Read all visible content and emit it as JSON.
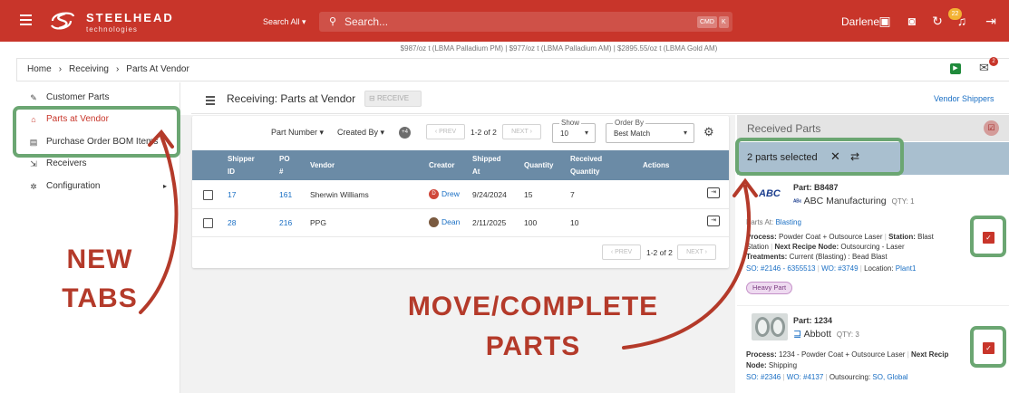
{
  "topbar": {
    "brand_name": "STEELHEAD",
    "brand_sub": "technologies",
    "search_scope": "Search All",
    "search_placeholder": "Search...",
    "kbd_1": "CMD",
    "kbd_2": "K",
    "user_name": "Darlene",
    "notification_count": "22",
    "brand_color": "#c8352a"
  },
  "metal_prices": "$987/oz t (LBMA Palladium PM)   |   $977/oz t (LBMA Palladium AM)   |   $2895.55/oz t (LBMA Gold AM)",
  "breadcrumb": {
    "items": [
      "Home",
      "Receiving",
      "Parts At Vendor"
    ],
    "mail_badge": "2"
  },
  "sidebar": {
    "items": [
      {
        "label": "Customer Parts",
        "icon": "wrench-icon"
      },
      {
        "label": "Parts at Vendor",
        "icon": "warehouse-icon"
      },
      {
        "label": "Purchase Order BOM Items",
        "icon": "document-icon"
      },
      {
        "label": "Receivers",
        "icon": "login-icon"
      },
      {
        "label": "Configuration",
        "icon": "gear-icon"
      }
    ]
  },
  "panel": {
    "title": "Receiving: Parts at Vendor",
    "receive_label": "RECEIVE",
    "vendor_shippers": "Vendor Shippers"
  },
  "controls": {
    "part_number": "Part Number",
    "created_by": "Created By",
    "avatar_count": "+4",
    "prev": "PREV",
    "page_info": "1-2 of 2",
    "next": "NEXT",
    "show_label": "Show",
    "show_value": "10",
    "order_label": "Order By",
    "order_value": "Best Match"
  },
  "table": {
    "headers": [
      "Shipper ID",
      "PO #",
      "Vendor",
      "Creator",
      "Shipped At",
      "Quantity",
      "Received Quantity",
      "Actions"
    ],
    "header_lines": {
      "shipper": [
        "Shipper",
        "ID"
      ],
      "po": [
        "PO",
        "#"
      ],
      "vendor": "Vendor",
      "creator": "Creator",
      "shipped": [
        "Shipped",
        "At"
      ],
      "quantity": "Quantity",
      "received": [
        "Received",
        "Quantity"
      ],
      "actions": "Actions"
    },
    "rows": [
      {
        "shipper_id": "17",
        "po": "161",
        "vendor": "Sherwin Williams",
        "creator_initial": "D",
        "creator": "Drew",
        "shipped_at": "9/24/2024",
        "quantity": "15",
        "received": "7"
      },
      {
        "shipper_id": "28",
        "po": "216",
        "vendor": "PPG",
        "creator_initial": "",
        "creator": "Dean",
        "shipped_at": "2/11/2025",
        "quantity": "100",
        "received": "10"
      }
    ],
    "footer_prev": "PREV",
    "footer_page": "1-2 of 2",
    "footer_next": "NEXT"
  },
  "received_parts": {
    "title": "Received Parts",
    "selected_text": "2 parts selected",
    "parts": [
      {
        "part_label": "Part: B8487",
        "customer": "ABC Manufacturing",
        "logo_text": "ABC",
        "qty": "QTY: 1",
        "parts_at_label": "Parts At:",
        "parts_at": "Blasting",
        "process_label": "Process:",
        "process": "Powder Coat + Outsource Laser",
        "station_label": "Station:",
        "station_a": "Blast",
        "station_b": "Station",
        "next_node_label": "Next Recipe Node:",
        "next_node": "Outsourcing - Laser",
        "treatments_label": "Treatments:",
        "treatments": "Current (Blasting) : Bead Blast",
        "so": "SO: #2146 - 6355513",
        "wo": "WO: #3749",
        "location_label": "Location:",
        "location": "Plant1",
        "tag": "Heavy Part"
      },
      {
        "part_label": "Part: 1234",
        "customer": "Abbott",
        "qty": "QTY: 3",
        "process_label": "Process:",
        "process": "1234 - Powder Coat + Outsource Laser",
        "next_node_label": "Next Recip",
        "node_label": "Node:",
        "node": "Shipping",
        "so": "SO: #2346",
        "wo": "WO: #4137",
        "outsourcing_label": "Outsourcing:",
        "outsourcing_a": "SO,",
        "outsourcing_b": "Global"
      }
    ]
  },
  "annotations": {
    "new_tabs_1": "NEW",
    "new_tabs_2": "TABS",
    "move_1": "MOVE/COMPLETE",
    "move_2": "PARTS",
    "highlight_color": "#6ba672",
    "arrow_color": "#b43a2a"
  }
}
